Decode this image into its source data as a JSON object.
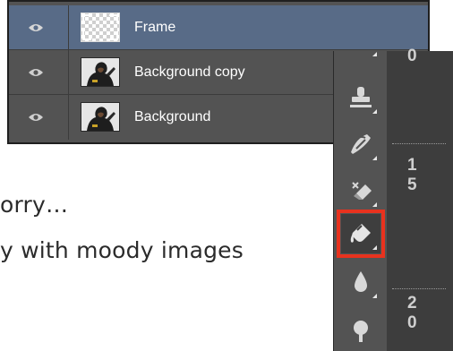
{
  "article": {
    "line1": "orry…",
    "line2": "y with moody images"
  },
  "layers": [
    {
      "name": "Frame",
      "selected": true,
      "thumb": "transparent"
    },
    {
      "name": "Background copy",
      "selected": false,
      "thumb": "photo"
    },
    {
      "name": "Background",
      "selected": false,
      "thumb": "photo"
    }
  ],
  "tools": [
    {
      "icon": "clone-stamp-icon"
    },
    {
      "icon": "history-brush-icon"
    },
    {
      "icon": "eraser-icon"
    },
    {
      "icon": "paint-bucket-icon",
      "highlighted": true
    },
    {
      "icon": "blur-drop-icon"
    },
    {
      "icon": "dodge-icon"
    }
  ],
  "ruler": {
    "top": "0",
    "a": "1",
    "b": "5",
    "c": "2",
    "d": "0"
  },
  "colors": {
    "panel": "#535353",
    "selected_row": "#586b87",
    "highlight": "#e8321e"
  }
}
